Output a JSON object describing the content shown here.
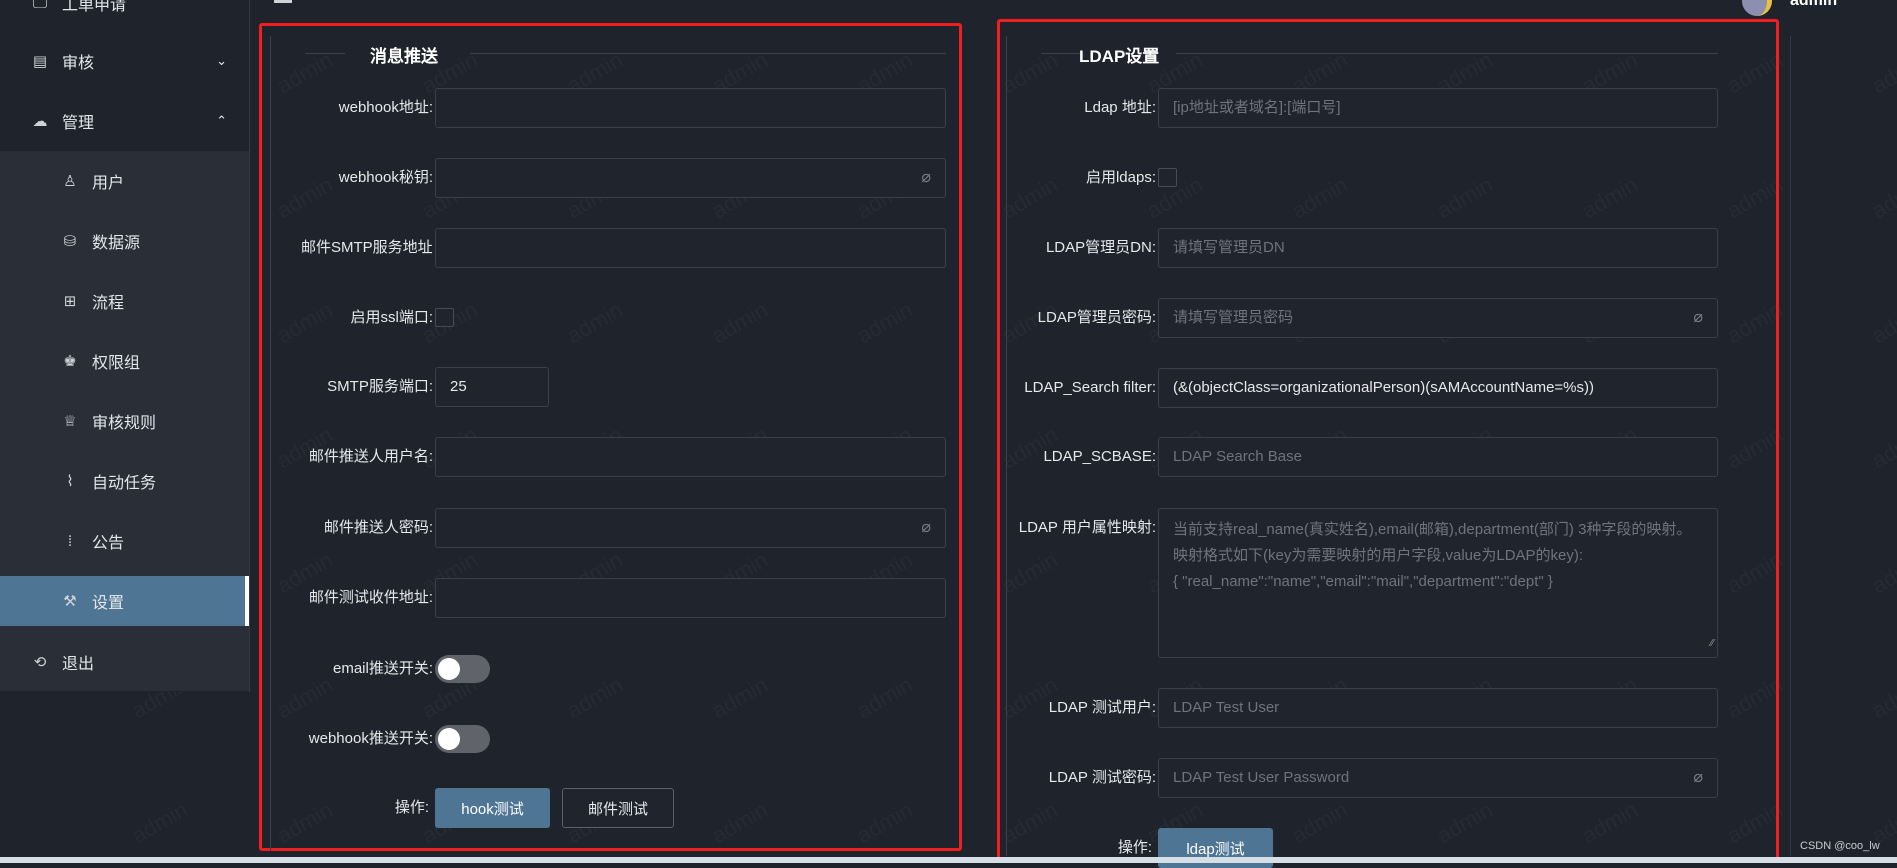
{
  "header": {
    "menu_icon": "hamburger-icon",
    "user": "admin"
  },
  "sidebar": {
    "items": [
      {
        "label": "工单申请",
        "icon": "monitor-icon"
      },
      {
        "label": "审核",
        "icon": "document-icon",
        "chevron": "chevron-down-icon"
      },
      {
        "label": "管理",
        "icon": "cloud-icon",
        "chevron": "chevron-up-icon"
      }
    ],
    "subitems": [
      {
        "label": "用户",
        "icon": "user-icon"
      },
      {
        "label": "数据源",
        "icon": "database-icon"
      },
      {
        "label": "流程",
        "icon": "flow-icon"
      },
      {
        "label": "权限组",
        "icon": "group-icon"
      },
      {
        "label": "审核规则",
        "icon": "crown-icon"
      },
      {
        "label": "自动任务",
        "icon": "paperclip-icon"
      },
      {
        "label": "公告",
        "icon": "chart-icon"
      },
      {
        "label": "设置",
        "icon": "wrench-icon",
        "active": true
      }
    ],
    "logout": {
      "label": "退出",
      "icon": "logout-icon"
    }
  },
  "message": {
    "legend": "消息推送",
    "rows": [
      {
        "label": "webhook地址:",
        "type": "input",
        "value": ""
      },
      {
        "label": "webhook秘钥:",
        "type": "password",
        "value": ""
      },
      {
        "label": "邮件SMTP服务地址:",
        "type": "input",
        "value": ""
      },
      {
        "label": "启用ssl端口:",
        "type": "checkbox",
        "checked": false
      },
      {
        "label": "SMTP服务端口:",
        "type": "short",
        "value": "25"
      },
      {
        "label": "邮件推送人用户名:",
        "type": "input",
        "value": ""
      },
      {
        "label": "邮件推送人密码:",
        "type": "password",
        "value": ""
      },
      {
        "label": "邮件测试收件地址:",
        "type": "input",
        "value": ""
      },
      {
        "label": "email推送开关:",
        "type": "switch",
        "on": false
      },
      {
        "label": "webhook推送开关:",
        "type": "switch",
        "on": false
      }
    ],
    "actions_label": "操作:",
    "buttons": [
      "hook测试",
      "邮件测试"
    ]
  },
  "ldap": {
    "legend": "LDAP设置",
    "rows": [
      {
        "label": "Ldap 地址:",
        "type": "input",
        "placeholder": "[ip地址或者域名]:[端口号]"
      },
      {
        "label": "启用ldaps:",
        "type": "checkbox",
        "checked": false
      },
      {
        "label": "LDAP管理员DN:",
        "type": "input",
        "placeholder": "请填写管理员DN"
      },
      {
        "label": "LDAP管理员密码:",
        "type": "password",
        "placeholder": "请填写管理员密码"
      },
      {
        "label": "LDAP_Search filter:",
        "type": "input",
        "value": "(&(objectClass=organizationalPerson)(sAMAccountName=%s))"
      },
      {
        "label": "LDAP_SCBASE:",
        "type": "input",
        "placeholder": "LDAP Search Base"
      },
      {
        "label": "LDAP 用户属性映射:",
        "type": "textarea",
        "placeholder": "当前支持real_name(真实姓名),email(邮箱),department(部门) 3种字段的映射。映射格式如下(key为需要映射的用户字段,value为LDAP的key):\n{ \"real_name\":\"name\",\"email\":\"mail\",\"department\":\"dept\" }"
      },
      {
        "label": "LDAP 测试用户:",
        "type": "input",
        "placeholder": "LDAP Test User"
      },
      {
        "label": "LDAP 测试密码:",
        "type": "password",
        "placeholder": "LDAP Test User Password"
      }
    ],
    "actions_label": "操作:",
    "buttons": [
      "ldap测试"
    ]
  },
  "watermark": "admin",
  "credit": "CSDN @coo_lw",
  "colors": {
    "accent": "#4f7594",
    "highlight": "#f01e1e",
    "background": "#1f232b"
  }
}
